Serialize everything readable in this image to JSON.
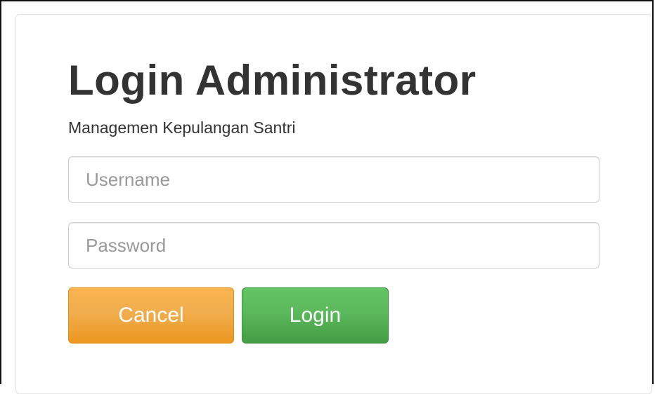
{
  "login_form": {
    "title": "Login Administrator",
    "subtitle": "Managemen Kepulangan Santri",
    "username": {
      "placeholder": "Username",
      "value": ""
    },
    "password": {
      "placeholder": "Password",
      "value": ""
    },
    "buttons": {
      "cancel_label": "Cancel",
      "login_label": "Login"
    }
  },
  "colors": {
    "cancel_button": "#f0ad4e",
    "login_button": "#5cb85c",
    "title_text": "#333333",
    "placeholder_text": "#999999"
  }
}
